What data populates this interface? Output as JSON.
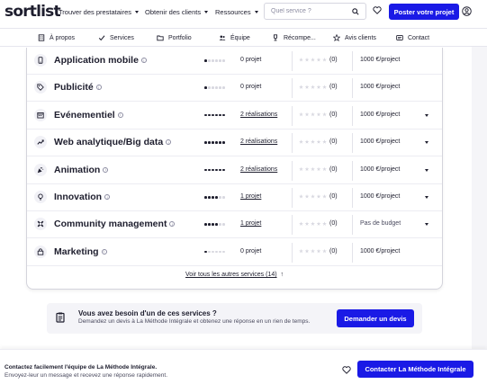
{
  "brand": {
    "logo": "sortlist",
    "accent": "#1a1ae6"
  },
  "nav": {
    "links": [
      "Trouver des prestataires",
      "Obtenir des clients",
      "Ressources"
    ],
    "search_placeholder": "Quel service ?",
    "post_button": "Poster votre projet"
  },
  "tabs": [
    {
      "label": "À propos",
      "icon": "building-icon"
    },
    {
      "label": "Services",
      "icon": "check-icon"
    },
    {
      "label": "Portfolio",
      "icon": "folder-icon"
    },
    {
      "label": "Équipe",
      "icon": "team-icon"
    },
    {
      "label": "Récompe...",
      "icon": "trophy-icon"
    },
    {
      "label": "Avis clients",
      "icon": "star-icon"
    },
    {
      "label": "Contact",
      "icon": "card-icon"
    }
  ],
  "services": [
    {
      "name": "Application mobile",
      "icon": "mobile-icon",
      "level": 1,
      "realisations": "0 projet",
      "is_link": false,
      "rating": "(0)",
      "budget": "1000 €/project",
      "expandable": false
    },
    {
      "name": "Publicité",
      "icon": "tag-icon",
      "level": 1,
      "realisations": "0 projet",
      "is_link": false,
      "rating": "(0)",
      "budget": "1000 €/project",
      "expandable": false
    },
    {
      "name": "Evénementiel",
      "icon": "event-icon",
      "level": 6,
      "realisations": "2 réalisations",
      "is_link": true,
      "rating": "(0)",
      "budget": "1000 €/project",
      "expandable": true
    },
    {
      "name": "Web analytique/Big data",
      "icon": "chart-icon",
      "level": 6,
      "realisations": "2 réalisations",
      "is_link": true,
      "rating": "(0)",
      "budget": "1000 €/project",
      "expandable": true
    },
    {
      "name": "Animation",
      "icon": "animation-icon",
      "level": 6,
      "realisations": "2 réalisations",
      "is_link": true,
      "rating": "(0)",
      "budget": "1000 €/project",
      "expandable": true
    },
    {
      "name": "Innovation",
      "icon": "bulb-icon",
      "level": 4,
      "realisations": "1 projet",
      "is_link": true,
      "rating": "(0)",
      "budget": "1000 €/project",
      "expandable": true
    },
    {
      "name": "Community management",
      "icon": "community-icon",
      "level": 4,
      "realisations": "1 projet",
      "is_link": true,
      "rating": "(0)",
      "budget": "Pas de budget",
      "expandable": true
    },
    {
      "name": "Marketing",
      "icon": "store-icon",
      "level": 1,
      "realisations": "0 projet",
      "is_link": false,
      "rating": "(0)",
      "budget": "1000 €/project",
      "expandable": false
    }
  ],
  "see_all": "Voir tous les autres services (14)",
  "banner": {
    "title": "Vous avez besoin d'un de ces services ?",
    "subtitle": "Demandez un devis à La Méthode Intégrale et obtenez une réponse en un rien de temps.",
    "button": "Demander un devis"
  },
  "sticky": {
    "title": "Contactez facilement l'équipe de La Méthode Intégrale.",
    "subtitle": "Envoyez-leur un message et recevez une réponse rapidement.",
    "button": "Contacter La Méthode Intégrale"
  }
}
